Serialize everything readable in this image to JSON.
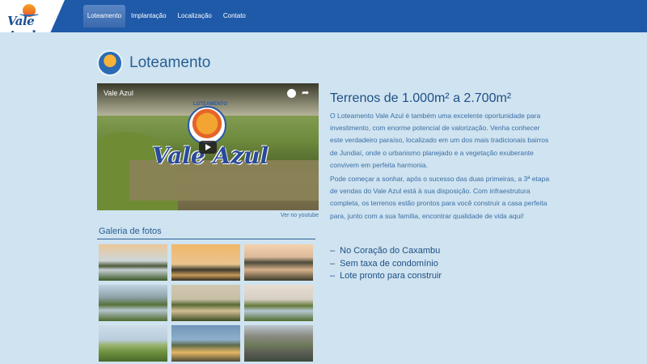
{
  "header": {
    "logo_text": "Vale Azul",
    "nav": [
      {
        "label": "Loteamento",
        "active": true
      },
      {
        "label": "Implantação",
        "active": false
      },
      {
        "label": "Localização",
        "active": false
      },
      {
        "label": "Contato",
        "active": false
      }
    ]
  },
  "page": {
    "title": "Loteamento"
  },
  "video": {
    "title": "Vale Azul",
    "badge_top": "LOTEAMENTO",
    "badge_name": "Vale Azul",
    "youtube_link": "Ver no youtube"
  },
  "gallery": {
    "title": "Galeria de fotos",
    "thumbnails": 9
  },
  "content": {
    "headline": "Terrenos de 1.000m² a 2.700m²",
    "paragraph_1": "O Loteamento Vale Azul é também uma excelente oportunidade para investimento, com enorme potencial de valorização. Venha conhecer este verdadeiro paraíso, localizado em um dos mais tradicionais bairros de Jundiaí, onde o urbanismo planejado e a vegetação exuberante convivem em perfeita harmonia.",
    "paragraph_2": "Pode começar a sonhar, após o sucesso das duas primeiras, a 3ª etapa de vendas do Vale Azul está à sua disposição. Com infraestrutura completa, os terrenos estão prontos para você construir a casa perfeita para, junto com a sua família, encontrar qualidade de vida aqui!",
    "features": [
      "No Coração do Caxambu",
      "Sem taxa de condomínio",
      "Lote pronto para construir"
    ]
  },
  "colors": {
    "page_bg": "#cfe3f0",
    "header_bg": "#1e5aa8",
    "text_primary": "#1f4f86",
    "text_body": "#3a6ea5"
  }
}
